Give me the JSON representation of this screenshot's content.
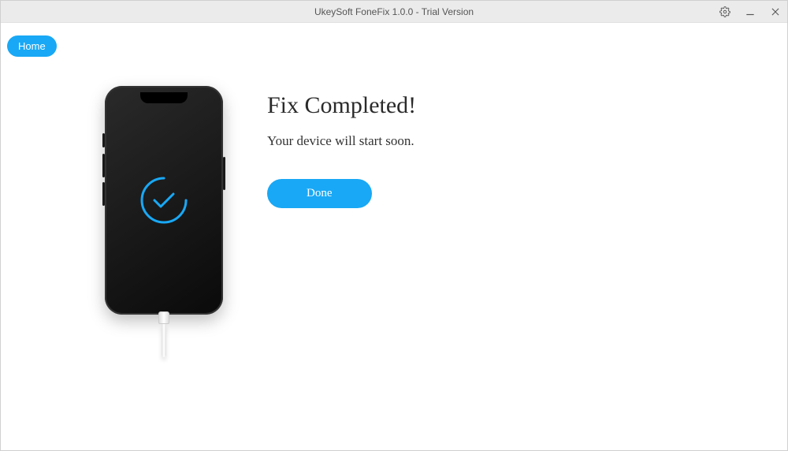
{
  "titlebar": {
    "title": "UkeySoft FoneFix 1.0.0 - Trial Version"
  },
  "nav": {
    "home_label": "Home"
  },
  "main": {
    "heading": "Fix Completed!",
    "subtext": "Your device will start soon.",
    "done_label": "Done"
  },
  "icons": {
    "settings": "gear-icon",
    "minimize": "minimize-icon",
    "close": "close-icon",
    "check": "checkmark-icon"
  },
  "colors": {
    "accent": "#19a8f5"
  }
}
